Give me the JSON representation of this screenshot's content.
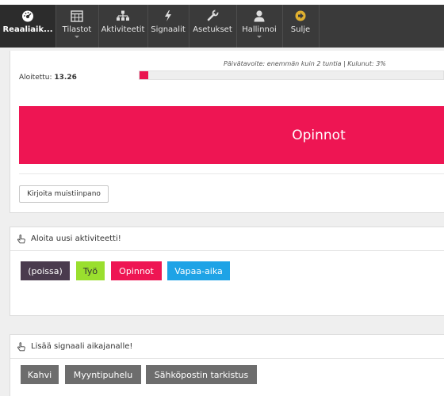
{
  "nav": {
    "items": [
      {
        "label": "Reaaliaik...",
        "icon": "dashboard-icon",
        "active": true
      },
      {
        "label": "Tilastot",
        "icon": "calendar-icon",
        "dropdown": true
      },
      {
        "label": "Aktiviteetit",
        "icon": "sitemap-icon"
      },
      {
        "label": "Signaalit",
        "icon": "bolt-icon"
      },
      {
        "label": "Asetukset",
        "icon": "wrench-icon"
      },
      {
        "label": "Hallinnoi",
        "icon": "user-icon",
        "dropdown": true
      },
      {
        "label": "Sulje",
        "icon": "exit-circle-icon",
        "accent": "#e0b030"
      }
    ]
  },
  "current": {
    "daily_goal": "Päivätavoite: enemmän kuin 2 tuntia | Kulunut: 3%",
    "started_label": "Aloitettu:",
    "started_time": "13.26",
    "progress_percent": 3,
    "activity_name": "Opinnot",
    "activity_color": "#ee1553",
    "note_button": "Kirjoita muistiinpano"
  },
  "start_activity": {
    "title": "Aloita uusi aktiviteetti!",
    "buttons": [
      {
        "label": "(poissa)",
        "color": "#4a3b4e"
      },
      {
        "label": "Työ",
        "color": "#9adf2e",
        "text_color": "#333333"
      },
      {
        "label": "Opinnot",
        "color": "#ee1553"
      },
      {
        "label": "Vapaa-aika",
        "color": "#1ea3e6"
      }
    ]
  },
  "signals": {
    "title": "Lisää signaali aikajanalle!",
    "buttons": [
      {
        "label": "Kahvi",
        "color": "#6d6d6d"
      },
      {
        "label": "Myyntipuhelu",
        "color": "#6d6d6d"
      },
      {
        "label": "Sähköpostin tarkistus",
        "color": "#6d6d6d"
      }
    ]
  }
}
